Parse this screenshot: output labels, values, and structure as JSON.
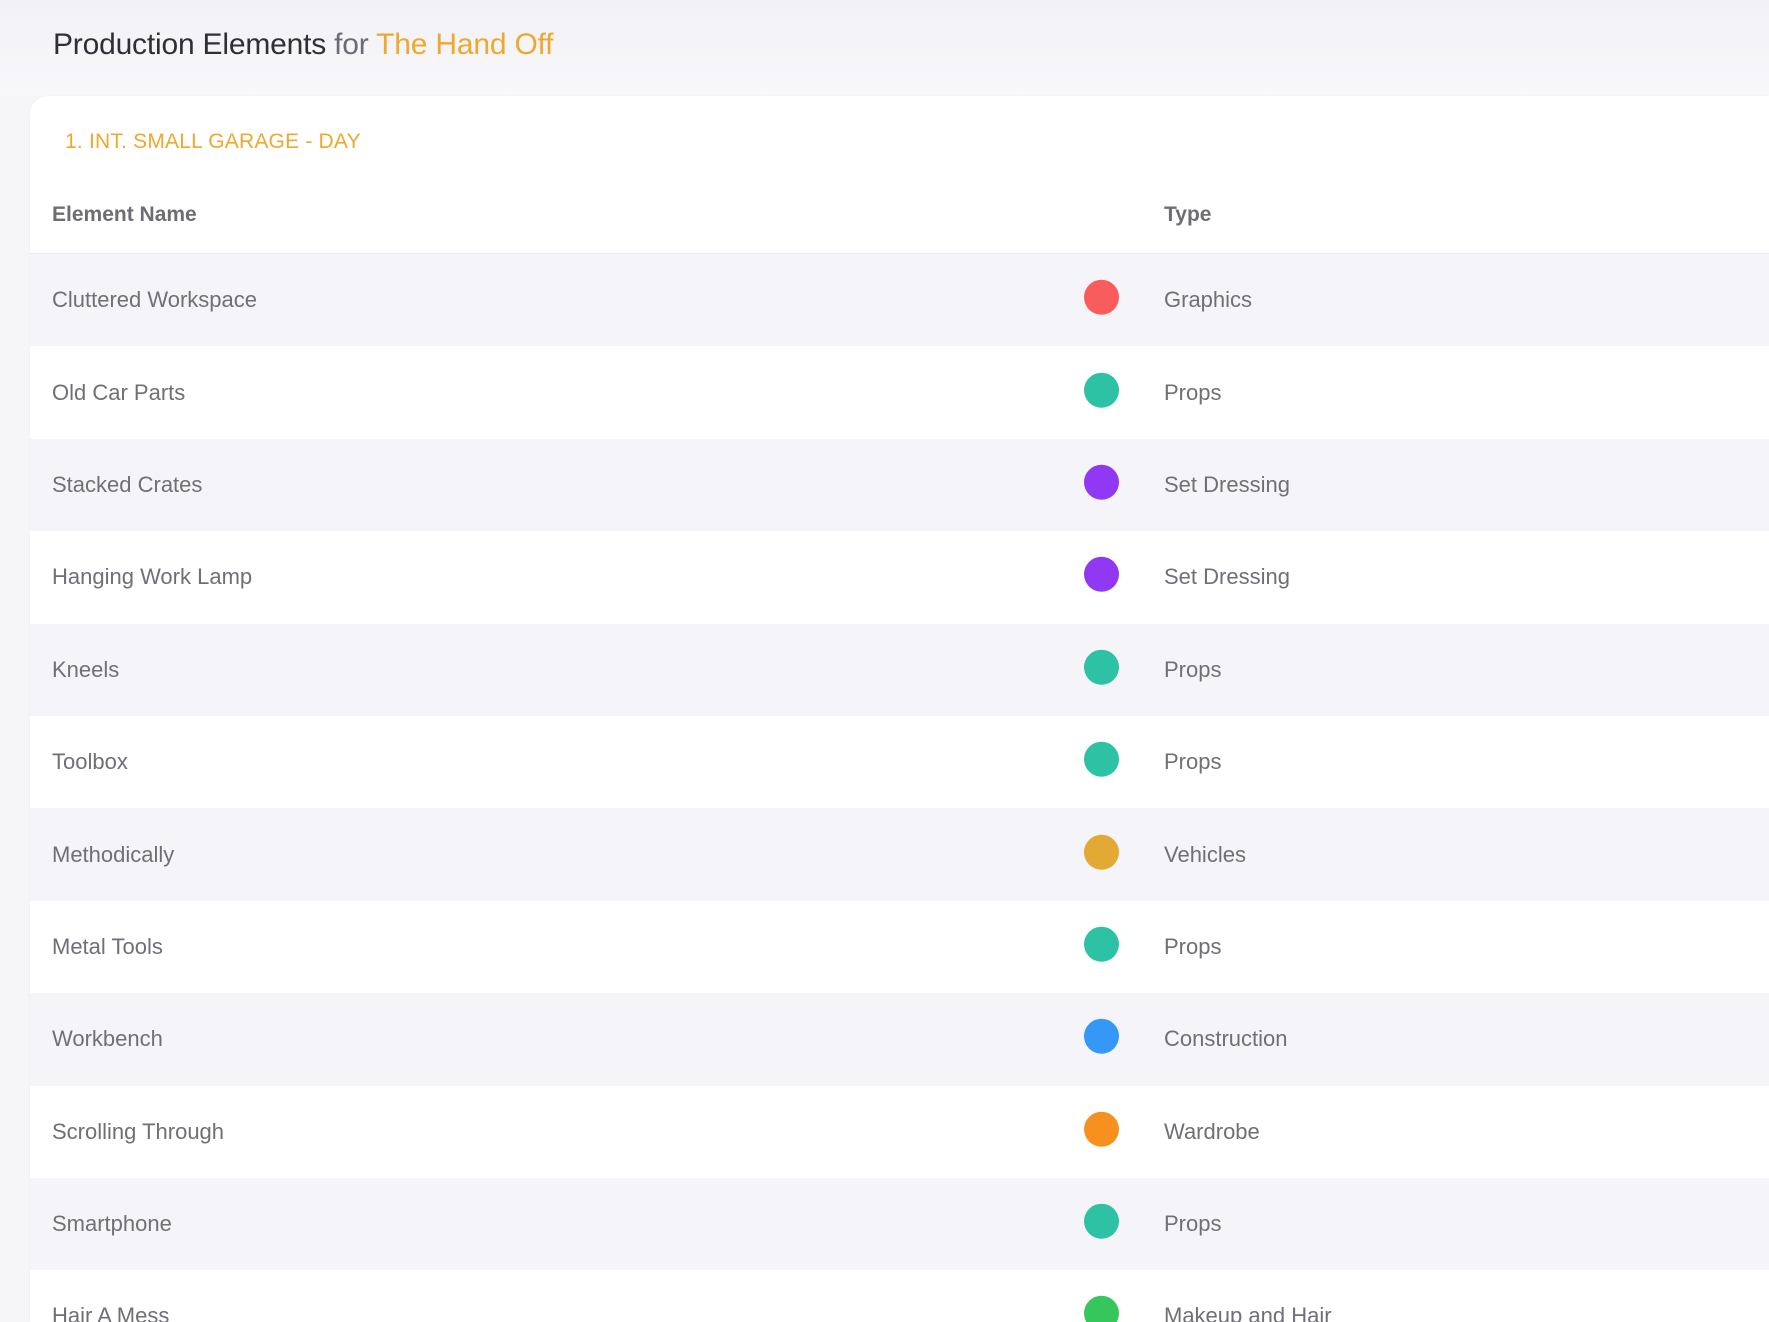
{
  "header": {
    "title_prefix": "Production Elements",
    "title_for": "for",
    "project_name": "The Hand Off"
  },
  "scene": {
    "heading": "1. INT. SMALL GARAGE - DAY"
  },
  "table": {
    "columns": {
      "name": "Element Name",
      "type": "Type"
    },
    "rows": [
      {
        "name": "Cluttered Workspace",
        "type": "Graphics",
        "color": "#f95c5c"
      },
      {
        "name": "Old Car Parts",
        "type": "Props",
        "color": "#2cc2a3"
      },
      {
        "name": "Stacked Crates",
        "type": "Set Dressing",
        "color": "#9138f5"
      },
      {
        "name": "Hanging Work Lamp",
        "type": "Set Dressing",
        "color": "#9138f5"
      },
      {
        "name": "Kneels",
        "type": "Props",
        "color": "#2cc2a3"
      },
      {
        "name": "Toolbox",
        "type": "Props",
        "color": "#2cc2a3"
      },
      {
        "name": "Methodically",
        "type": "Vehicles",
        "color": "#e2a935"
      },
      {
        "name": "Metal Tools",
        "type": "Props",
        "color": "#2cc2a3"
      },
      {
        "name": "Workbench",
        "type": "Construction",
        "color": "#3598f6"
      },
      {
        "name": "Scrolling Through",
        "type": "Wardrobe",
        "color": "#f6901f"
      },
      {
        "name": "Smartphone",
        "type": "Props",
        "color": "#2cc2a3"
      },
      {
        "name": "Hair A Mess",
        "type": "Makeup and Hair",
        "color": "#36c75c"
      }
    ]
  }
}
